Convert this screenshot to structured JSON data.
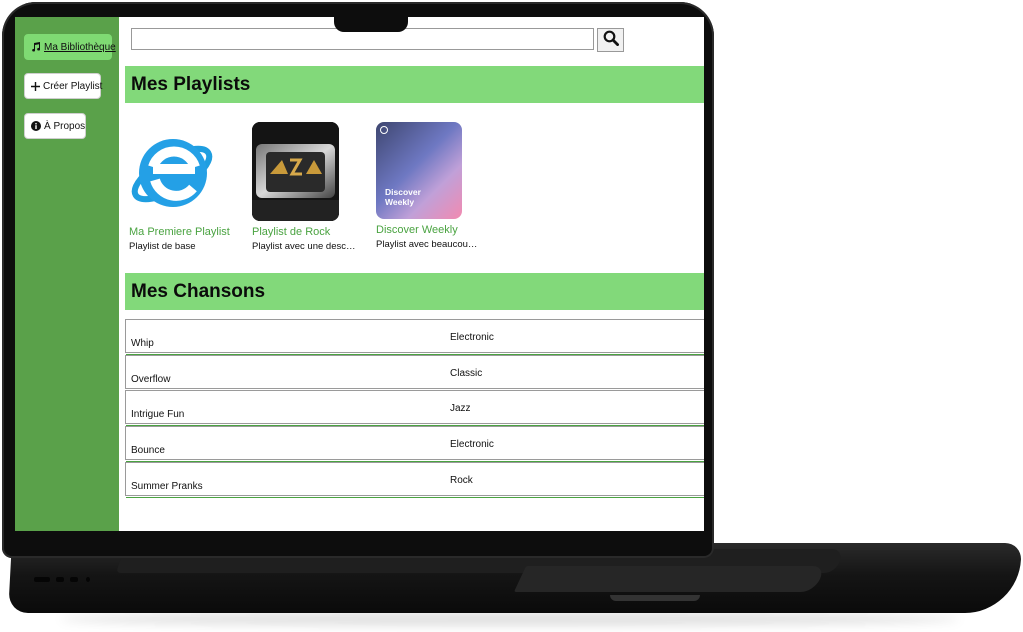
{
  "sidebar": {
    "items": [
      {
        "label": "Ma Bibliothèque",
        "icon": "music-note-icon",
        "active": true
      },
      {
        "label": "Créer Playlist",
        "icon": "plus-icon",
        "active": false
      },
      {
        "label": "À Propos",
        "icon": "info-icon",
        "active": false
      }
    ]
  },
  "search": {
    "value": "",
    "placeholder": ""
  },
  "playlists_section": {
    "title": "Mes Playlists"
  },
  "playlists": [
    {
      "name": "Ma Premiere Playlist",
      "description": "Playlist de base",
      "cover": "internet-explorer-logo"
    },
    {
      "name": "Playlist de Rock",
      "description": "Playlist avec une description",
      "cover": "acdc-logo"
    },
    {
      "name": "Discover Weekly",
      "description": "Playlist avec beaucoup de chansons",
      "cover_text": "Discover Weekly"
    }
  ],
  "songs_section": {
    "title": "Mes Chansons"
  },
  "songs": [
    {
      "title": "Whip",
      "genre": "Electronic"
    },
    {
      "title": "Overflow",
      "genre": "Classic"
    },
    {
      "title": "Intrigue Fun",
      "genre": "Jazz"
    },
    {
      "title": "Bounce",
      "genre": "Electronic"
    },
    {
      "title": "Summer Pranks",
      "genre": "Rock"
    }
  ],
  "colors": {
    "sidebar": "#5aa14a",
    "header": "#82d97a",
    "accent_text": "#4aa341",
    "active_button": "#7fda73"
  }
}
